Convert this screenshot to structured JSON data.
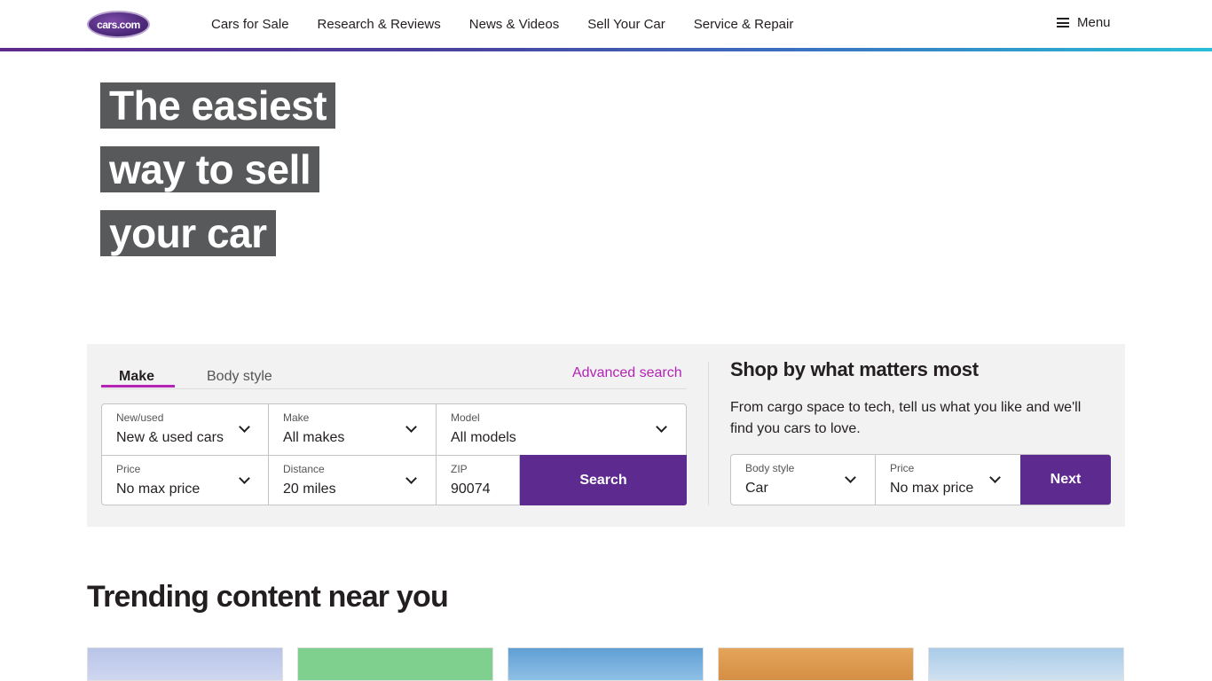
{
  "header": {
    "logo_text": "cars.com",
    "nav": [
      "Cars for Sale",
      "Research & Reviews",
      "News & Videos",
      "Sell Your Car",
      "Service & Repair"
    ],
    "menu_label": "Menu"
  },
  "hero": {
    "lines": [
      "The easiest",
      "way to sell",
      "your car"
    ]
  },
  "search": {
    "tabs": [
      "Make",
      "Body style"
    ],
    "advanced_link": "Advanced search",
    "fields": {
      "new_used": {
        "label": "New/used",
        "value": "New & used cars"
      },
      "make": {
        "label": "Make",
        "value": "All makes"
      },
      "model": {
        "label": "Model",
        "value": "All models"
      },
      "price": {
        "label": "Price",
        "value": "No max price"
      },
      "distance": {
        "label": "Distance",
        "value": "20 miles"
      },
      "zip": {
        "label": "ZIP",
        "value": "90074"
      }
    },
    "search_button": "Search"
  },
  "shop": {
    "title": "Shop by what matters most",
    "description": "From cargo space to tech, tell us what you like and we'll find you cars to love.",
    "fields": {
      "body_style": {
        "label": "Body style",
        "value": "Car"
      },
      "price": {
        "label": "Price",
        "value": "No max price"
      }
    },
    "next_button": "Next"
  },
  "trending": {
    "title": "Trending content near you"
  },
  "colors": {
    "brand_purple": "#5d2a8f",
    "accent_magenta": "#b323b6",
    "hero_bg": "#58595b"
  }
}
